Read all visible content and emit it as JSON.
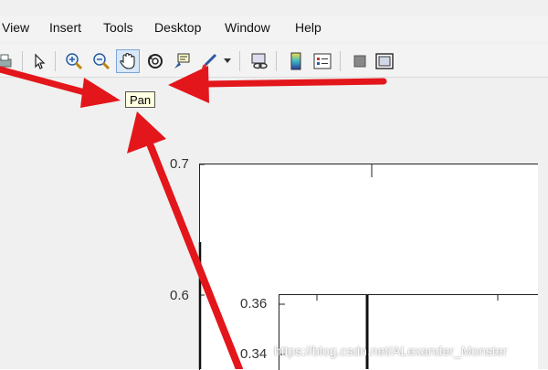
{
  "menu": {
    "items": [
      "View",
      "Insert",
      "Tools",
      "Desktop",
      "Window",
      "Help"
    ]
  },
  "toolbar": {
    "tools": [
      {
        "name": "print-icon"
      },
      {
        "name": "edit-plot-icon"
      },
      {
        "name": "zoom-in-icon"
      },
      {
        "name": "zoom-out-icon"
      },
      {
        "name": "pan-icon",
        "active": true
      },
      {
        "name": "rotate-3d-icon"
      },
      {
        "name": "data-cursor-icon"
      },
      {
        "name": "brush-icon"
      },
      {
        "name": "link-plot-icon"
      },
      {
        "name": "colorbar-icon"
      },
      {
        "name": "legend-icon"
      },
      {
        "name": "hide-plot-tools-icon"
      },
      {
        "name": "show-plot-tools-icon"
      }
    ]
  },
  "tooltip": {
    "text": "Pan"
  },
  "axes_main": {
    "yticks": [
      "0.7",
      "0.6"
    ]
  },
  "axes_inset": {
    "yticks": [
      "0.36",
      "0.34"
    ]
  },
  "watermark": {
    "text": "https://blog.csdn.net/ALexander_Monster"
  },
  "colors": {
    "arrow": "#e3161b",
    "tooltip_bg": "#ffffe1",
    "active_tool": "#d8e8f8"
  }
}
